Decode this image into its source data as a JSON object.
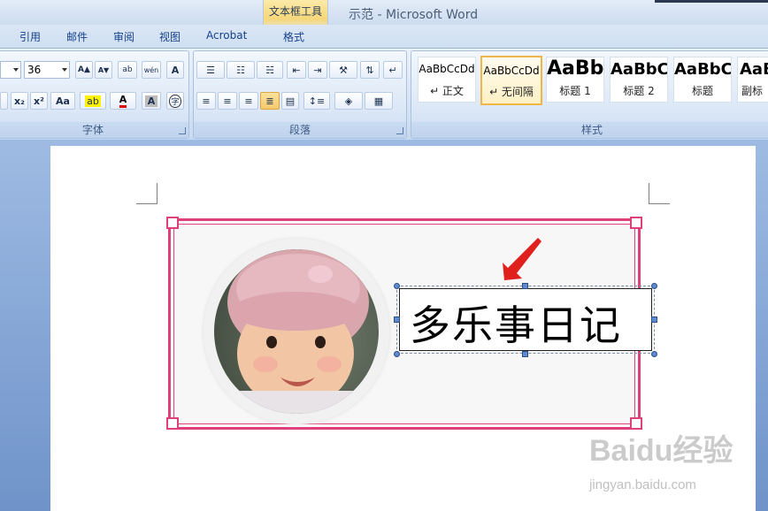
{
  "window": {
    "contextual_tab_group": "文本框工具",
    "title": "示范 - Microsoft Word"
  },
  "tabs": [
    "引用",
    "邮件",
    "审阅",
    "视图",
    "Acrobat",
    "格式"
  ],
  "font_group": {
    "label": "字体",
    "font_size": "36",
    "buttons": [
      "A▲",
      "A▼",
      "ab",
      "wén",
      "A",
      "x₂",
      "x²",
      "Aa",
      "ab",
      "A",
      "A",
      "字"
    ]
  },
  "paragraph_group": {
    "label": "段落"
  },
  "styles_group": {
    "label": "样式",
    "styles": [
      {
        "sample": "AaBbCcDd",
        "name": "↵ 正文"
      },
      {
        "sample": "AaBbCcDd",
        "name": "↵ 无间隔"
      },
      {
        "sample": "AaBb",
        "name": "标题 1"
      },
      {
        "sample": "AaBbC",
        "name": "标题 2"
      },
      {
        "sample": "AaBbC",
        "name": "标题"
      },
      {
        "sample": "AaB",
        "name": "副标"
      }
    ]
  },
  "document": {
    "textbox_text": "多乐事日记"
  },
  "watermark": {
    "brand": "Baidu经验",
    "url": "jingyan.baidu.com"
  },
  "colors": {
    "frame": "#e0407a",
    "accent_arrow": "#e0201c",
    "ribbon": "#d7e4f5"
  }
}
